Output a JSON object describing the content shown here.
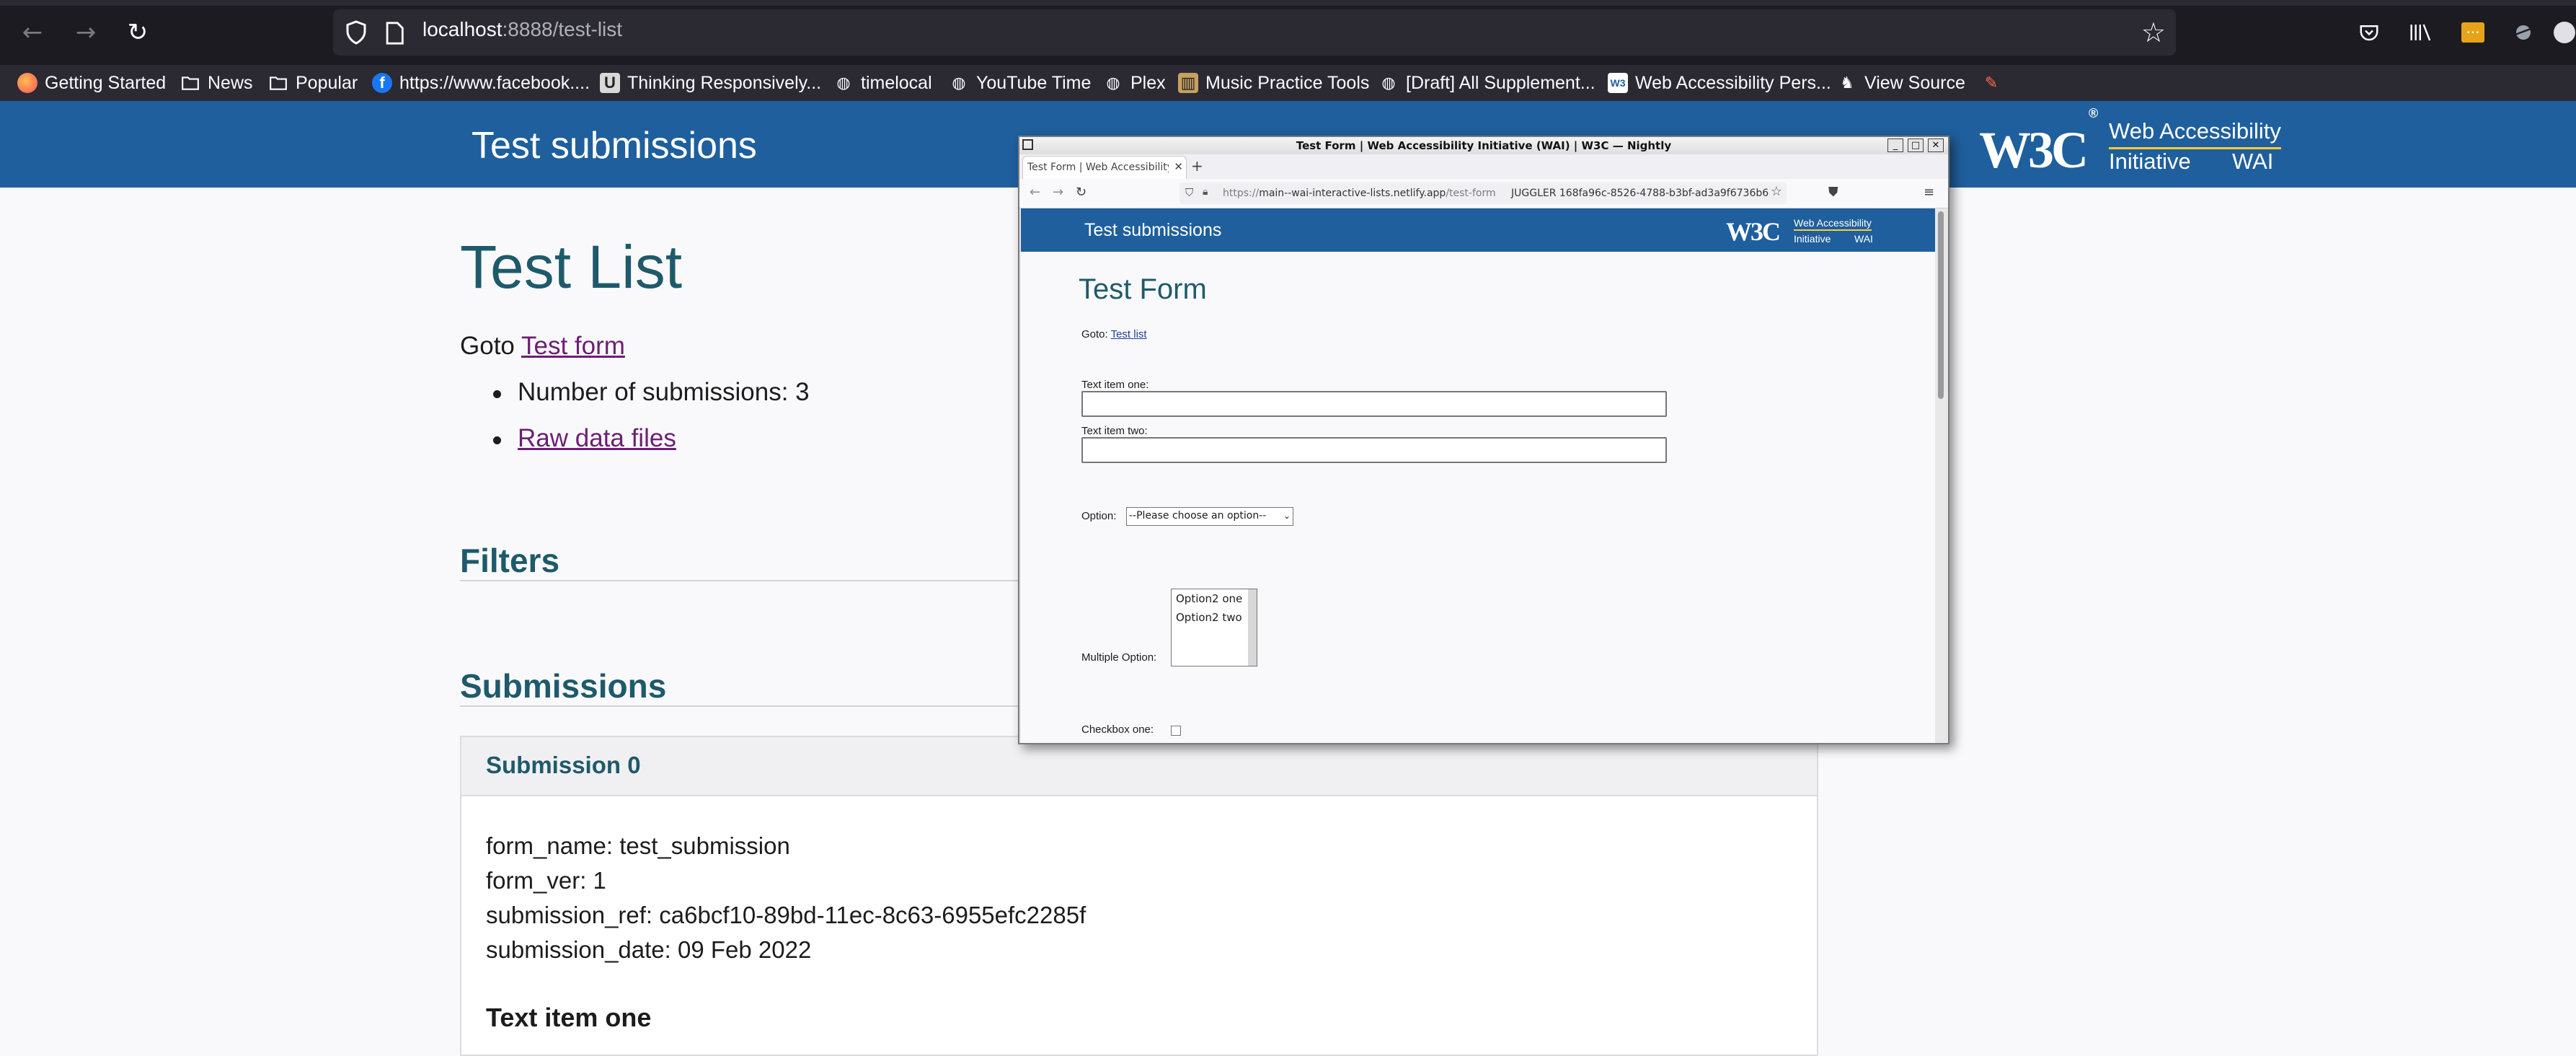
{
  "browser": {
    "url_host": "localhost",
    "url_path": ":8888/test-list",
    "icons": {
      "back": "back-arrow-icon",
      "forward": "forward-arrow-icon",
      "reload": "reload-icon",
      "star": "star-icon"
    }
  },
  "bookmarks": [
    {
      "label": "Getting Started",
      "icon": "firefox-icon"
    },
    {
      "label": "News",
      "icon": "folder-icon"
    },
    {
      "label": "Popular",
      "icon": "folder-icon"
    },
    {
      "label": "https://www.facebook....",
      "icon": "facebook-icon"
    },
    {
      "label": "Thinking Responsively...",
      "icon": "site-icon"
    },
    {
      "label": "timelocal",
      "icon": "globe-icon"
    },
    {
      "label": "YouTube Time",
      "icon": "globe-icon"
    },
    {
      "label": "Plex",
      "icon": "globe-icon"
    },
    {
      "label": "Music Practice Tools",
      "icon": "site-icon"
    },
    {
      "label": "[Draft] All Supplement...",
      "icon": "globe-icon"
    },
    {
      "label": "Web Accessibility Pers...",
      "icon": "w3c-icon"
    },
    {
      "label": "View Source",
      "icon": "rabbit-icon"
    }
  ],
  "header": {
    "site_title": "Test submissions",
    "logo": "W3C",
    "logo_reg": "®",
    "wai_title": "Web Accessibility",
    "wai_sub1": "Initiative",
    "wai_sub2": "WAI"
  },
  "main": {
    "title": "Test List",
    "goto_prefix": "Goto ",
    "goto_link": "Test form",
    "count_label": "Number of submissions: 3",
    "raw_link": "Raw data files",
    "filters_heading": "Filters",
    "submissions_heading": "Submissions"
  },
  "submission": {
    "title": "Submission 0",
    "form_name": "form_name: test_submission",
    "form_ver": "form_ver: 1",
    "ref": "submission_ref: ca6bcf10-89bd-11ec-8c63-6955efc2285f",
    "date": "submission_date: 09 Feb 2022",
    "section": "Text item one"
  },
  "popup": {
    "window_title": "Test Form | Web Accessibility Initiative (WAI) | W3C — Nightly",
    "tab_label": "Test Form | Web Accessibility Ini",
    "url_prefix": "https://",
    "url_host": "main--wai-interactive-lists.netlify.app",
    "url_path": "/test-form",
    "url_extra": "JUGGLER 168fa96c-8526-4788-b3bf-ad3a9f6736b6",
    "site_title": "Test submissions",
    "logo": "W3C",
    "wai_title": "Web Accessibility",
    "wai_sub1": "Initiative",
    "wai_sub2": "WAI",
    "heading": "Test Form",
    "goto_prefix": "Goto: ",
    "goto_link": "Test list",
    "text_one_label": "Text item one:",
    "text_two_label": "Text item two:",
    "option_label": "Option:",
    "option_selected": "--Please choose an option--",
    "multi_label": "Multiple Option:",
    "multi_options": [
      "Option2 one",
      "Option2 two"
    ],
    "checkbox_label": "Checkbox one:"
  }
}
